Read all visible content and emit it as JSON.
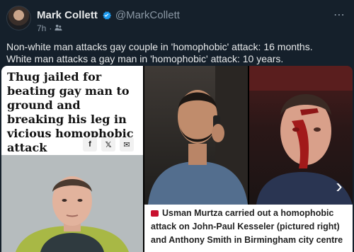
{
  "tweet": {
    "display_name": "Mark Collett",
    "handle": "@MarkCollett",
    "time": "7h",
    "more_icon": "more-horizontal-icon",
    "verified_icon": "verified-badge-icon",
    "text_line1": "Non-white man attacks gay couple in 'homophobic' attack: 16 months.",
    "text_line2": "White man attacks a gay man in 'homophobic' attack: 10 years."
  },
  "media": {
    "headline": "Thug jailed for beating gay man to ground and breaking his leg in vicious homophobic attack",
    "share_buttons": [
      "f",
      "𝕏",
      "✉"
    ],
    "caption": "Usman Murtza carried out a homophobic attack on John-Paul Kesseler (pictured right) and Anthony Smith in Birmingham city centre",
    "next_icon": "chevron-right-icon"
  },
  "colors": {
    "background": "#15202b",
    "verified": "#1d9bf0",
    "caption_icon": "#c8102e"
  }
}
